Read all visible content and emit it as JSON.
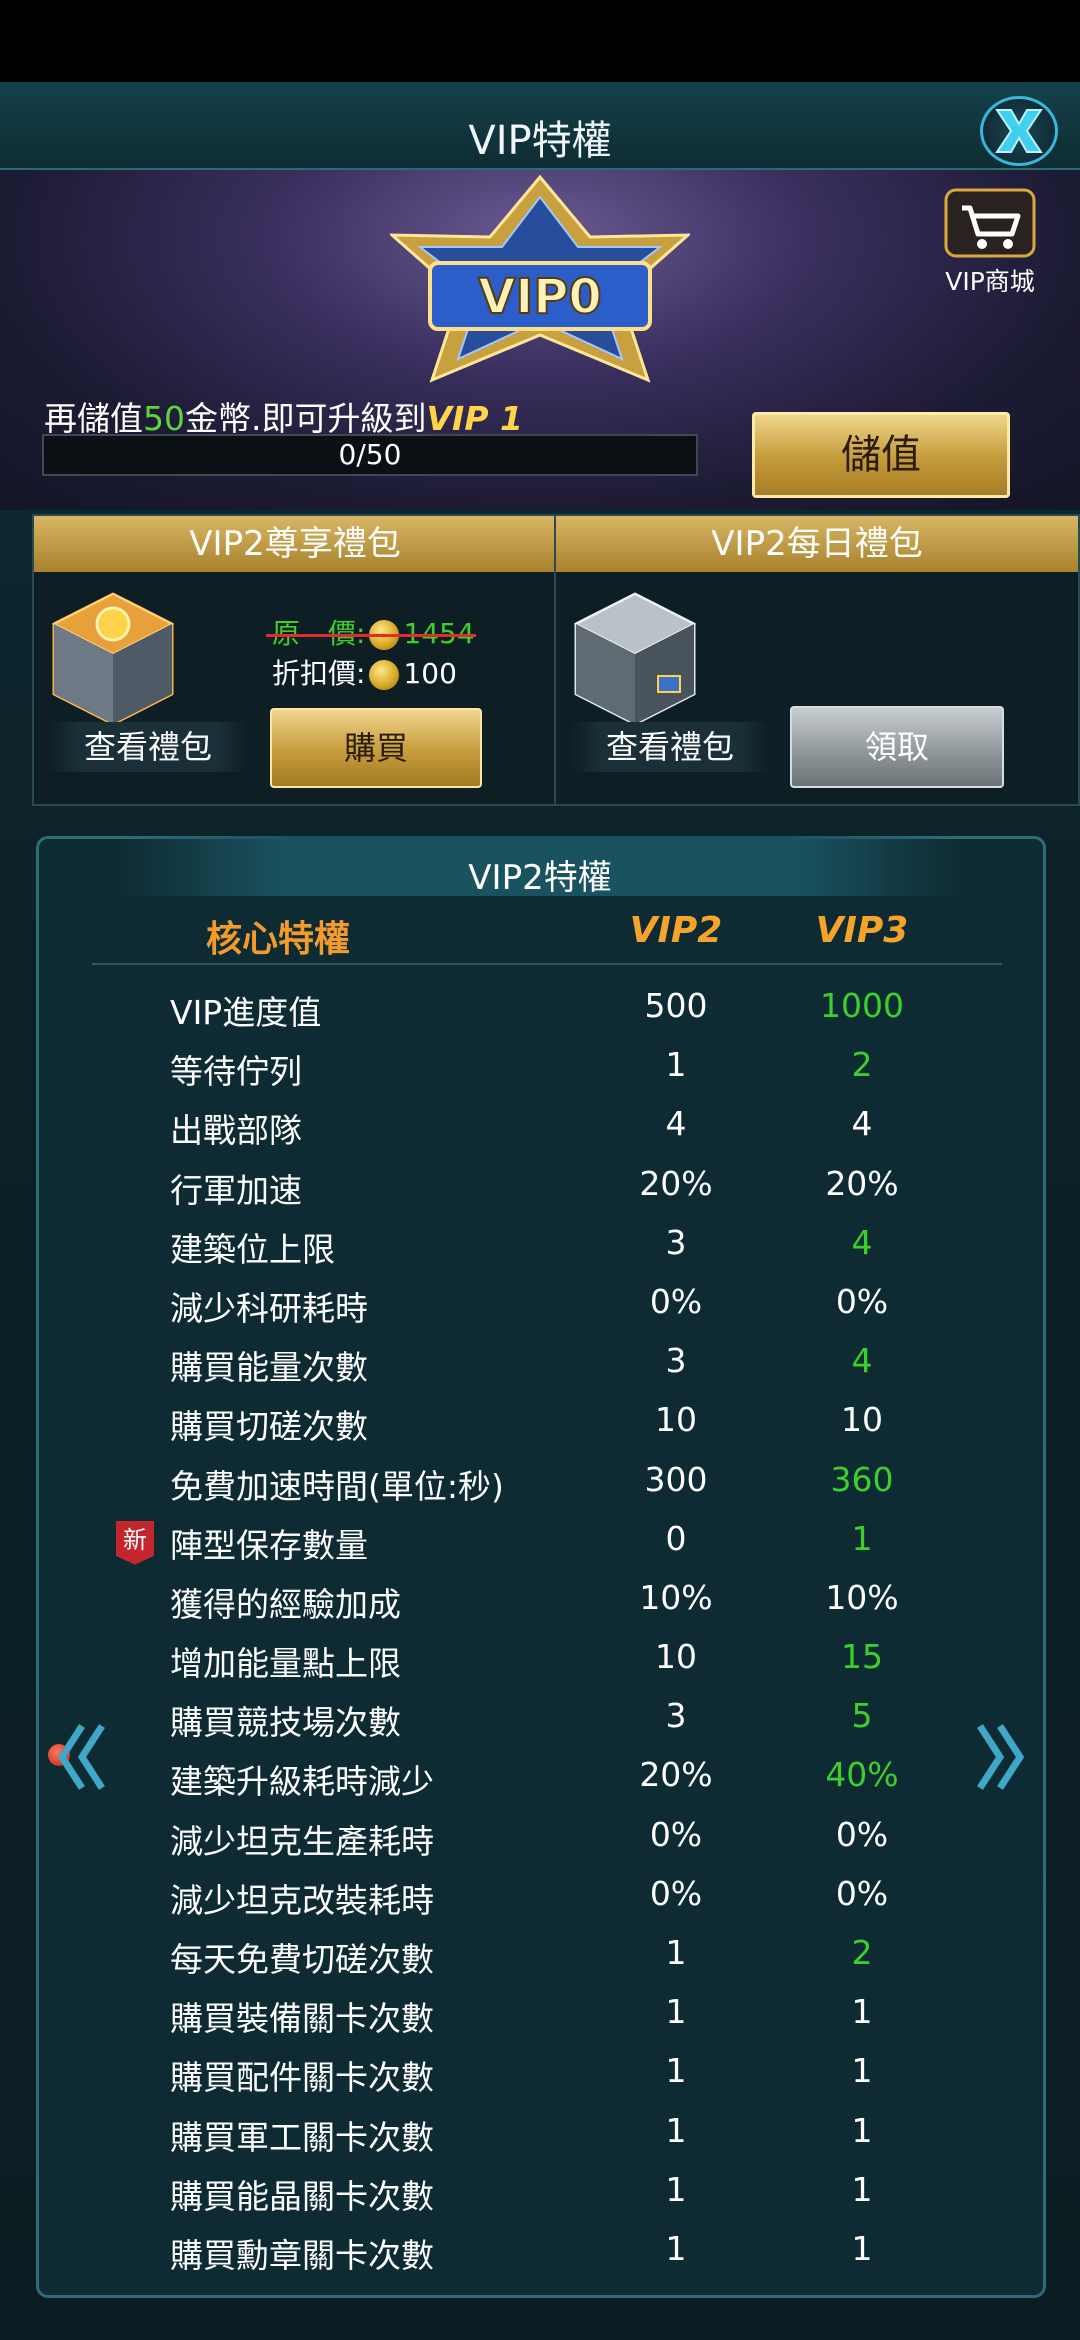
{
  "window": {
    "title": "VIP特權"
  },
  "header": {
    "badge_text": "VIP0",
    "shop_label": "VIP商城",
    "upgrade_prefix": "再儲值",
    "upgrade_amount": "50",
    "upgrade_suffix": "金幣.即可升級到",
    "upgrade_target": "VIP 1",
    "progress_text": "0/50",
    "progress_fraction": 0,
    "deposit_label": "儲值"
  },
  "packs": [
    {
      "title": "VIP2尊享禮包",
      "original_label": "原　價:",
      "original_price": "1454",
      "discount_label": "折扣價:",
      "discount_price": "100",
      "view_label": "查看禮包",
      "action_label": "購買"
    },
    {
      "title": "VIP2每日禮包",
      "view_label": "查看禮包",
      "action_label": "領取"
    }
  ],
  "privileges": {
    "title": "VIP2特權",
    "core_title": "核心特權",
    "col_current": "VIP2",
    "col_next": "VIP3",
    "rows": [
      {
        "name": "VIP進度值",
        "current": "500",
        "next": "1000",
        "improved": true
      },
      {
        "name": "等待佇列",
        "current": "1",
        "next": "2",
        "improved": true
      },
      {
        "name": "出戰部隊",
        "current": "4",
        "next": "4",
        "improved": false
      },
      {
        "name": "行軍加速",
        "current": "20%",
        "next": "20%",
        "improved": false
      },
      {
        "name": "建築位上限",
        "current": "3",
        "next": "4",
        "improved": true
      },
      {
        "name": "減少科研耗時",
        "current": "0%",
        "next": "0%",
        "improved": false
      },
      {
        "name": "購買能量次數",
        "current": "3",
        "next": "4",
        "improved": true
      },
      {
        "name": "購買切磋次數",
        "current": "10",
        "next": "10",
        "improved": false
      },
      {
        "name": "免費加速時間(單位:秒)",
        "current": "300",
        "next": "360",
        "improved": true
      },
      {
        "name": "陣型保存數量",
        "current": "0",
        "next": "1",
        "improved": true,
        "new_tag": "新"
      },
      {
        "name": "獲得的經驗加成",
        "current": "10%",
        "next": "10%",
        "improved": false
      },
      {
        "name": "增加能量點上限",
        "current": "10",
        "next": "15",
        "improved": true
      },
      {
        "name": "購買競技場次數",
        "current": "3",
        "next": "5",
        "improved": true
      },
      {
        "name": "建築升級耗時減少",
        "current": "20%",
        "next": "40%",
        "improved": true
      },
      {
        "name": "減少坦克生產耗時",
        "current": "0%",
        "next": "0%",
        "improved": false
      },
      {
        "name": "減少坦克改裝耗時",
        "current": "0%",
        "next": "0%",
        "improved": false
      },
      {
        "name": "每天免費切磋次數",
        "current": "1",
        "next": "2",
        "improved": true
      },
      {
        "name": "購買裝備關卡次數",
        "current": "1",
        "next": "1",
        "improved": false
      },
      {
        "name": "購買配件關卡次數",
        "current": "1",
        "next": "1",
        "improved": false
      },
      {
        "name": "購買軍工關卡次數",
        "current": "1",
        "next": "1",
        "improved": false
      },
      {
        "name": "購買能晶關卡次數",
        "current": "1",
        "next": "1",
        "improved": false
      },
      {
        "name": "購買勳章關卡次數",
        "current": "1",
        "next": "1",
        "improved": false
      }
    ]
  },
  "colors": {
    "improved": "#3fcf2c",
    "gold": "#d9a93c",
    "accent": "#3bb6d8"
  },
  "icons": {
    "close": "close-x-icon",
    "shop": "cart-icon",
    "prev": "double-chevron-left-icon",
    "next": "double-chevron-right-icon",
    "coin": "coin-icon"
  }
}
